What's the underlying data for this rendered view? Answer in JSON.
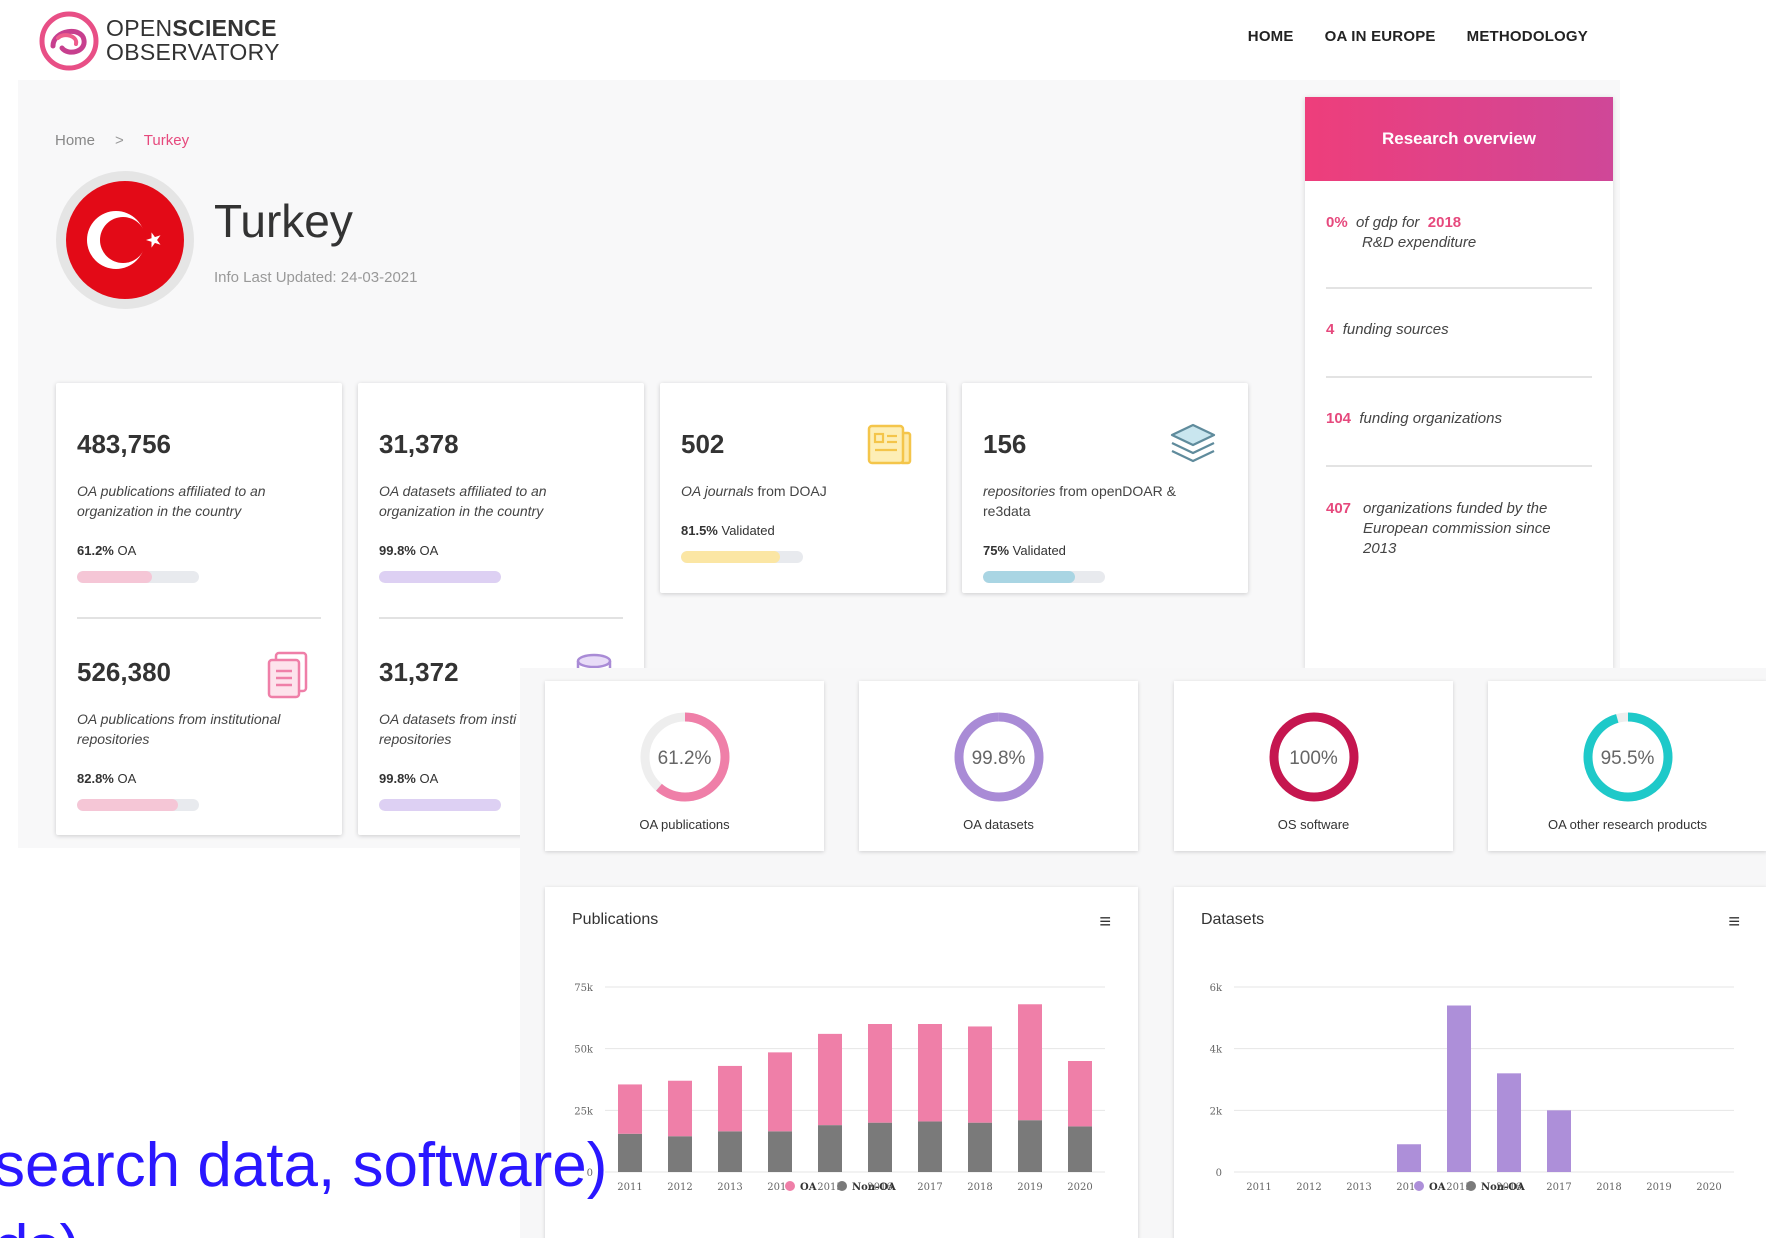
{
  "header": {
    "logo_text_light": "OPEN",
    "logo_text_bold": "SCIENCE",
    "logo_text_line2": "OBSERVATORY",
    "nav": [
      "HOME",
      "OA IN EUROPE",
      "METHODOLOGY"
    ]
  },
  "breadcrumb": {
    "home": "Home",
    "sep": ">",
    "current": "Turkey"
  },
  "country": {
    "name": "Turkey",
    "updated": "Info Last Updated: 24-03-2021"
  },
  "stats": {
    "pubs": {
      "value": "483,756",
      "desc": "OA publications affiliated to an organization in the country",
      "pct": "61.2%",
      "pct_label": "OA",
      "fill": 0.612,
      "color": "#f5c6d6"
    },
    "datasets": {
      "value": "31,378",
      "desc": "OA datasets affiliated to an organization in the country",
      "pct": "99.8%",
      "pct_label": "OA",
      "fill": 0.998,
      "color": "#ddd0f3"
    },
    "journals": {
      "value": "502",
      "desc_em": "OA journals",
      "desc_rest": " from DOAJ",
      "pct": "81.5%",
      "pct_label": "Validated",
      "fill": 0.815,
      "color": "#fbe6a4"
    },
    "repos": {
      "value": "156",
      "desc_em": "repositories",
      "desc_rest": " from openDOAR & re3data",
      "pct": "75%",
      "pct_label": "Validated",
      "fill": 0.75,
      "color": "#a9d5e3"
    },
    "inst_pubs": {
      "value": "526,380",
      "desc": "OA publications from institutional repositories",
      "pct": "82.8%",
      "pct_label": "OA",
      "fill": 0.828,
      "color": "#f5c6d6"
    },
    "inst_datasets": {
      "value": "31,372",
      "desc": "OA datasets from insti",
      "desc2": "repositories",
      "pct": "99.8%",
      "pct_label": "OA",
      "fill": 0.998,
      "color": "#ddd0f3"
    }
  },
  "research_overview": {
    "title": "Research overview",
    "gdp_value": "0%",
    "gdp_text": "of gdp for",
    "gdp_year": "2018",
    "gdp_text2": "R&D expenditure",
    "funding_sources_n": "4",
    "funding_sources": "funding sources",
    "funding_orgs_n": "104",
    "funding_orgs": "funding organizations",
    "ec_n": "407",
    "ec_text": "organizations funded by the European commission since 2013"
  },
  "donuts": [
    {
      "pct": "61.2%",
      "value": 0.612,
      "label": "OA publications",
      "color": "#ef7fa8"
    },
    {
      "pct": "99.8%",
      "value": 0.998,
      "label": "OA datasets",
      "color": "#a98bd6"
    },
    {
      "pct": "100%",
      "value": 1.0,
      "label": "OS software",
      "color": "#c5164f"
    },
    {
      "pct": "95.5%",
      "value": 0.955,
      "label": "OA other research products",
      "color": "#1ec9c9"
    }
  ],
  "chart_data": [
    {
      "type": "bar",
      "title": "Publications",
      "categories": [
        "2011",
        "2012",
        "2013",
        "2014",
        "2015",
        "2016",
        "2017",
        "2018",
        "2019",
        "2020"
      ],
      "ylim": [
        0,
        75000
      ],
      "yticks": [
        "0",
        "25k",
        "50k",
        "75k"
      ],
      "stacked": true,
      "series": [
        {
          "name": "Non-OA",
          "color": "#7a7a7a",
          "values": [
            15500,
            14500,
            16500,
            16500,
            19000,
            20000,
            20500,
            20000,
            21000,
            18500
          ]
        },
        {
          "name": "OA",
          "color": "#ef7fa8",
          "values": [
            20000,
            22500,
            26500,
            32000,
            37000,
            40000,
            39500,
            39000,
            47000,
            26500
          ]
        }
      ],
      "legend": [
        "OA",
        "Non-OA"
      ]
    },
    {
      "type": "bar",
      "title": "Datasets",
      "categories": [
        "2011",
        "2012",
        "2013",
        "2014",
        "2015",
        "2016",
        "2017",
        "2018",
        "2019",
        "2020"
      ],
      "ylim": [
        0,
        6000
      ],
      "yticks": [
        "0",
        "2k",
        "4k",
        "6k"
      ],
      "stacked": true,
      "series": [
        {
          "name": "Non-OA",
          "color": "#7a7a7a",
          "values": [
            0,
            0,
            0,
            0,
            0,
            0,
            0,
            0,
            0,
            0
          ]
        },
        {
          "name": "OA",
          "color": "#ad8fd9",
          "values": [
            0,
            0,
            0,
            900,
            5400,
            3200,
            2000,
            0,
            0,
            0
          ]
        }
      ],
      "legend": [
        "OA",
        "Non-OA"
      ]
    }
  ],
  "caption": {
    "line1": "search data, software)",
    "line2": "ds)"
  },
  "colors": {
    "accent": "#e6497d"
  }
}
